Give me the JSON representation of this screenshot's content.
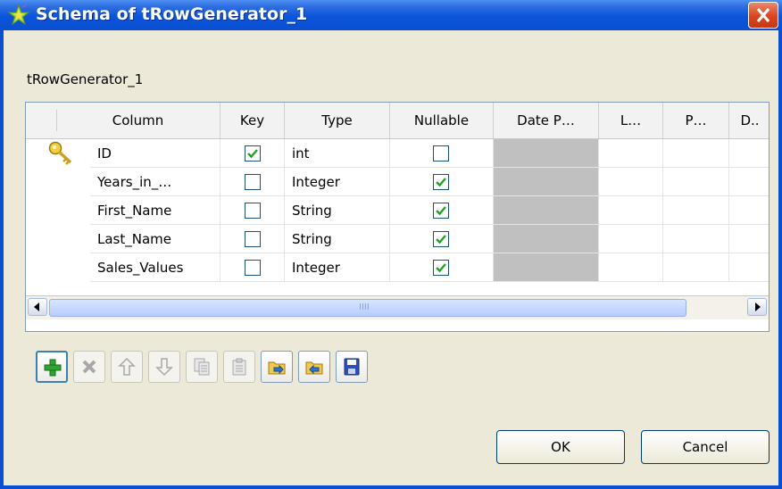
{
  "window": {
    "title": "Schema of tRowGenerator_1",
    "close_label": "×"
  },
  "component_label": "tRowGenerator_1",
  "table": {
    "columns": [
      "Column",
      "Key",
      "Type",
      "Nullable",
      "Date P…",
      "L…",
      "P…",
      "D.."
    ],
    "rows": [
      {
        "column": "ID",
        "key": true,
        "type": "int",
        "nullable": false
      },
      {
        "column": "Years_in_…",
        "key": false,
        "type": "Integer",
        "nullable": true
      },
      {
        "column": "First_Name",
        "key": false,
        "type": "String",
        "nullable": true
      },
      {
        "column": "Last_Name",
        "key": false,
        "type": "String",
        "nullable": true
      },
      {
        "column": "Sales_Values",
        "key": false,
        "type": "Integer",
        "nullable": true
      }
    ],
    "scroll_grip": "IIII"
  },
  "toolbar": {
    "buttons": [
      {
        "name": "add-button",
        "icon": "plus-icon",
        "enabled": true
      },
      {
        "name": "delete-button",
        "icon": "x-icon",
        "enabled": false
      },
      {
        "name": "move-up-button",
        "icon": "arrow-up-icon",
        "enabled": false
      },
      {
        "name": "move-down-button",
        "icon": "arrow-down-icon",
        "enabled": false
      },
      {
        "name": "copy-button",
        "icon": "copy-icon",
        "enabled": false
      },
      {
        "name": "paste-button",
        "icon": "paste-icon",
        "enabled": false
      },
      {
        "name": "import-button",
        "icon": "import-icon",
        "enabled": true
      },
      {
        "name": "export-button",
        "icon": "export-icon",
        "enabled": true
      },
      {
        "name": "save-button",
        "icon": "save-icon",
        "enabled": true
      }
    ]
  },
  "buttons": {
    "ok_label": "OK",
    "cancel_label": "Cancel"
  },
  "colors": {
    "titlebar": "#0a54da",
    "check": "#21a121",
    "disabled_cell": "#c0c0c0"
  }
}
